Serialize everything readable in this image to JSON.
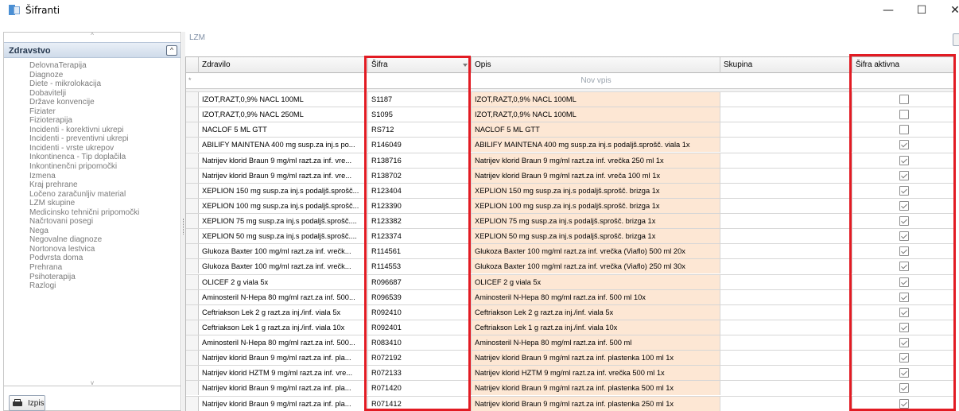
{
  "window": {
    "title": "Šifranti",
    "minimize": "—",
    "maximize": "☐",
    "close": "✕"
  },
  "sidebar": {
    "header": "Zdravstvo",
    "collapse_glyph": "^",
    "scroll_up": "^",
    "scroll_down": "v",
    "items": [
      "DelovnaTerapija",
      "Diagnoze",
      "Diete - mikrolokacija",
      "Dobavitelji",
      "Države konvencije",
      "Fiziater",
      "Fizioterapija",
      "Incidenti - korektivni ukrepi",
      "Incidenti - preventivni ukrepi",
      "Incidenti - vrste ukrepov",
      "Inkontinenca - Tip doplačila",
      "Inkontinenčni pripomočki",
      "Izmena",
      "Kraj prehrane",
      "Ločeno zaračunljiv material",
      "LZM skupine",
      "Medicinsko tehnični pripomočki",
      "Načrtovani posegi",
      "Nega",
      "Negovalne diagnoze",
      "Nortonova lestvica",
      "Podvrsta doma",
      "Prehrana",
      "Psihoterapija",
      "Razlogi"
    ],
    "print_label": "Izpis"
  },
  "main": {
    "section_label": "LZM",
    "columns": {
      "zdravilo": "Zdravilo",
      "sifra": "Šifra",
      "opis": "Opis",
      "skupina": "Skupina",
      "aktivna": "Šifra aktivna"
    },
    "new_row_text": "Nov vpis",
    "new_row_marker": "*",
    "rows": [
      {
        "zdravilo": "IZOT,RAZT,0,9% NACL 100ML",
        "sifra": "S1187",
        "opis": "IZOT,RAZT,0,9% NACL 100ML",
        "skupina": "",
        "aktivna": false
      },
      {
        "zdravilo": "IZOT,RAZT,0,9% NACL 250ML",
        "sifra": "S1095",
        "opis": "IZOT,RAZT,0,9% NACL 100ML",
        "skupina": "",
        "aktivna": false
      },
      {
        "zdravilo": "NACLOF 5 ML GTT",
        "sifra": "RS712",
        "opis": "NACLOF 5 ML GTT",
        "skupina": "",
        "aktivna": false
      },
      {
        "zdravilo": "ABILIFY MAINTENA 400 mg susp.za inj.s po...",
        "sifra": "R146049",
        "opis": "ABILIFY MAINTENA 400 mg susp.za inj.s podaljš.sprošč. viala 1x",
        "skupina": "",
        "aktivna": true
      },
      {
        "zdravilo": "Natrijev klorid Braun 9 mg/ml razt.za inf. vre...",
        "sifra": "R138716",
        "opis": "Natrijev klorid Braun 9 mg/ml razt.za inf. vrečka 250 ml 1x",
        "skupina": "",
        "aktivna": true
      },
      {
        "zdravilo": "Natrijev klorid Braun 9 mg/ml razt.za inf. vre...",
        "sifra": "R138702",
        "opis": "Natrijev klorid Braun 9 mg/ml razt.za inf. vreča 100 ml 1x",
        "skupina": "",
        "aktivna": true
      },
      {
        "zdravilo": "XEPLION 150 mg susp.za inj.s podaljš.sprošč...",
        "sifra": "R123404",
        "opis": "XEPLION 150 mg susp.za inj.s podaljš.sprošč. brizga 1x",
        "skupina": "",
        "aktivna": true
      },
      {
        "zdravilo": "XEPLION 100 mg susp.za inj.s podaljš.sprošč...",
        "sifra": "R123390",
        "opis": "XEPLION 100 mg susp.za inj.s podaljš.sprošč. brizga 1x",
        "skupina": "",
        "aktivna": true
      },
      {
        "zdravilo": "XEPLION 75 mg susp.za inj.s podaljš.sprošč....",
        "sifra": "R123382",
        "opis": "XEPLION 75 mg susp.za inj.s podaljš.sprošč. brizga 1x",
        "skupina": "",
        "aktivna": true
      },
      {
        "zdravilo": "XEPLION 50 mg susp.za inj.s podaljš.sprošč....",
        "sifra": "R123374",
        "opis": "XEPLION 50 mg susp.za inj.s podaljš.sprošč. brizga 1x",
        "skupina": "",
        "aktivna": true
      },
      {
        "zdravilo": "Glukoza Baxter 100 mg/ml razt.za inf. vrečk...",
        "sifra": "R114561",
        "opis": "Glukoza Baxter 100 mg/ml razt.za inf. vrečka (Viaflo) 500 ml 20x",
        "skupina": "",
        "aktivna": true
      },
      {
        "zdravilo": "Glukoza Baxter 100 mg/ml razt.za inf. vrečk...",
        "sifra": "R114553",
        "opis": "Glukoza Baxter 100 mg/ml razt.za inf. vrečka (Viaflo) 250 ml 30x",
        "skupina": "",
        "aktivna": true
      },
      {
        "zdravilo": "OLICEF 2 g viala 5x",
        "sifra": "R096687",
        "opis": "OLICEF 2 g viala 5x",
        "skupina": "",
        "aktivna": true
      },
      {
        "zdravilo": "Aminosteril N-Hepa 80 mg/ml razt.za inf. 500...",
        "sifra": "R096539",
        "opis": "Aminosteril N-Hepa 80 mg/ml razt.za inf. 500 ml 10x",
        "skupina": "",
        "aktivna": true
      },
      {
        "zdravilo": "Ceftriakson Lek 2 g razt.za inj./inf. viala 5x",
        "sifra": "R092410",
        "opis": "Ceftriakson Lek 2 g razt.za inj./inf. viala 5x",
        "skupina": "",
        "aktivna": true
      },
      {
        "zdravilo": "Ceftriakson Lek 1 g razt.za inj./inf. viala 10x",
        "sifra": "R092401",
        "opis": "Ceftriakson Lek 1 g razt.za inj./inf. viala 10x",
        "skupina": "",
        "aktivna": true
      },
      {
        "zdravilo": "Aminosteril N-Hepa 80 mg/ml razt.za inf. 500...",
        "sifra": "R083410",
        "opis": "Aminosteril N-Hepa 80 mg/ml razt.za inf. 500 ml",
        "skupina": "",
        "aktivna": true
      },
      {
        "zdravilo": "Natrijev klorid Braun 9 mg/ml razt.za inf. pla...",
        "sifra": "R072192",
        "opis": "Natrijev klorid Braun 9 mg/ml razt.za inf. plastenka 100 ml 1x",
        "skupina": "",
        "aktivna": true
      },
      {
        "zdravilo": "Natrijev klorid HZTM 9 mg/ml razt.za inf. vre...",
        "sifra": "R072133",
        "opis": "Natrijev klorid HZTM 9 mg/ml razt.za inf. vrečka 500 ml 1x",
        "skupina": "",
        "aktivna": true
      },
      {
        "zdravilo": "Natrijev klorid Braun 9 mg/ml razt.za inf. pla...",
        "sifra": "R071420",
        "opis": "Natrijev klorid Braun 9 mg/ml razt.za inf. plastenka 500 ml 1x",
        "skupina": "",
        "aktivna": true
      },
      {
        "zdravilo": "Natrijev klorid Braun 9 mg/ml razt.za inf. pla...",
        "sifra": "R071412",
        "opis": "Natrijev klorid Braun 9 mg/ml razt.za inf. plastenka 250 ml 1x",
        "skupina": "",
        "aktivna": true
      }
    ]
  },
  "colors": {
    "highlight": "#e21b23",
    "opis_background": "#fde7d4",
    "sidebar_header": "#cfdbea"
  }
}
